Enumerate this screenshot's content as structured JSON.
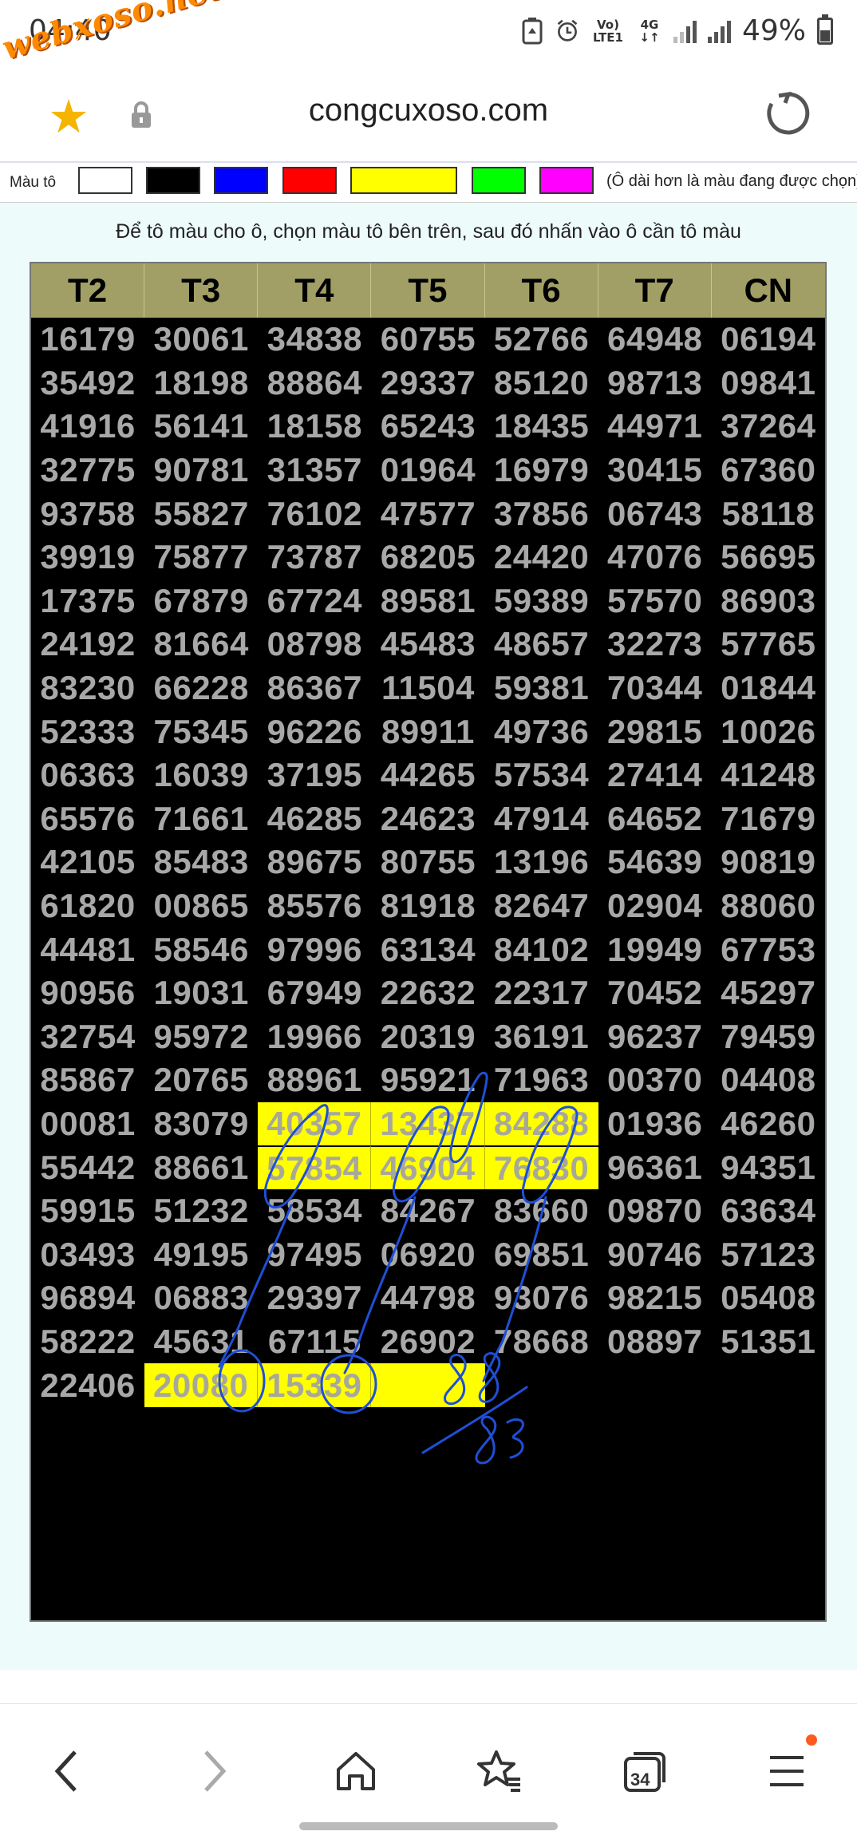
{
  "status_bar": {
    "time": "04:40",
    "watermark": "webxoso.net",
    "network_label": "Vo) LTE1",
    "network_type": "4G",
    "battery": "49%"
  },
  "browser": {
    "url": "congcuxoso.com",
    "icons": [
      "star-icon",
      "lock-icon",
      "reload-icon"
    ]
  },
  "palette": {
    "label": "Màu tô",
    "colors": [
      "#ffffff",
      "#000000",
      "#0000ff",
      "#ff0000",
      "#ffff00",
      "#00ff00",
      "#ff00ff"
    ],
    "selected": "#ffff00",
    "note": "(Ô dài hơn là màu đang được chọn)"
  },
  "instruction": "Để tô màu cho ô, chọn màu tô bên trên, sau đó nhấn vào ô cần tô màu",
  "table": {
    "headers": [
      "T2",
      "T3",
      "T4",
      "T5",
      "T6",
      "T7",
      "CN"
    ],
    "rows": [
      [
        "16179",
        "30061",
        "34838",
        "60755",
        "52766",
        "64948",
        "06194"
      ],
      [
        "35492",
        "18198",
        "88864",
        "29337",
        "85120",
        "98713",
        "09841"
      ],
      [
        "41916",
        "56141",
        "18158",
        "65243",
        "18435",
        "44971",
        "37264"
      ],
      [
        "32775",
        "90781",
        "31357",
        "01964",
        "16979",
        "30415",
        "67360"
      ],
      [
        "93758",
        "55827",
        "76102",
        "47577",
        "37856",
        "06743",
        "58118"
      ],
      [
        "39919",
        "75877",
        "73787",
        "68205",
        "24420",
        "47076",
        "56695"
      ],
      [
        "17375",
        "67879",
        "67724",
        "89581",
        "59389",
        "57570",
        "86903"
      ],
      [
        "24192",
        "81664",
        "08798",
        "45483",
        "48657",
        "32273",
        "57765"
      ],
      [
        "83230",
        "66228",
        "86367",
        "11504",
        "59381",
        "70344",
        "01844"
      ],
      [
        "52333",
        "75345",
        "96226",
        "89911",
        "49736",
        "29815",
        "10026"
      ],
      [
        "06363",
        "16039",
        "37195",
        "44265",
        "57534",
        "27414",
        "41248"
      ],
      [
        "65576",
        "71661",
        "46285",
        "24623",
        "47914",
        "64652",
        "71679"
      ],
      [
        "42105",
        "85483",
        "89675",
        "80755",
        "13196",
        "54639",
        "90819"
      ],
      [
        "61820",
        "00865",
        "85576",
        "81918",
        "82647",
        "02904",
        "88060"
      ],
      [
        "44481",
        "58546",
        "97996",
        "63134",
        "84102",
        "19949",
        "67753"
      ],
      [
        "90956",
        "19031",
        "67949",
        "22632",
        "22317",
        "70452",
        "45297"
      ],
      [
        "32754",
        "95972",
        "19966",
        "20319",
        "36191",
        "96237",
        "79459"
      ],
      [
        "85867",
        "20765",
        "88961",
        "95921",
        "71963",
        "00370",
        "04408"
      ],
      [
        "00081",
        "83079",
        "40357",
        "13437",
        "84288",
        "01936",
        "46260"
      ],
      [
        "55442",
        "88661",
        "57854",
        "46904",
        "76830",
        "96361",
        "94351"
      ],
      [
        "59915",
        "51232",
        "58534",
        "84267",
        "83660",
        "09870",
        "63634"
      ],
      [
        "03493",
        "49195",
        "97495",
        "06920",
        "69851",
        "90746",
        "57123"
      ],
      [
        "96894",
        "06883",
        "29397",
        "44798",
        "93076",
        "98215",
        "05408"
      ],
      [
        "58222",
        "45631",
        "67115",
        "26902",
        "78668",
        "08897",
        "51351"
      ],
      [
        "22406",
        "20080",
        "15339",
        "",
        "",
        "",
        ""
      ]
    ],
    "highlighted": [
      [
        18,
        2
      ],
      [
        18,
        3
      ],
      [
        18,
        4
      ],
      [
        19,
        2
      ],
      [
        19,
        3
      ],
      [
        19,
        4
      ],
      [
        24,
        1
      ],
      [
        24,
        2
      ],
      [
        24,
        3
      ]
    ]
  },
  "annotation": {
    "top_number": "88",
    "bottom_number": "83",
    "ink_color": "#1f4fd6"
  },
  "bottom_nav": {
    "tabs_count": "34",
    "icons": [
      "back-icon",
      "forward-icon",
      "home-icon",
      "bookmarks-icon",
      "tabs-icon",
      "menu-icon"
    ]
  }
}
